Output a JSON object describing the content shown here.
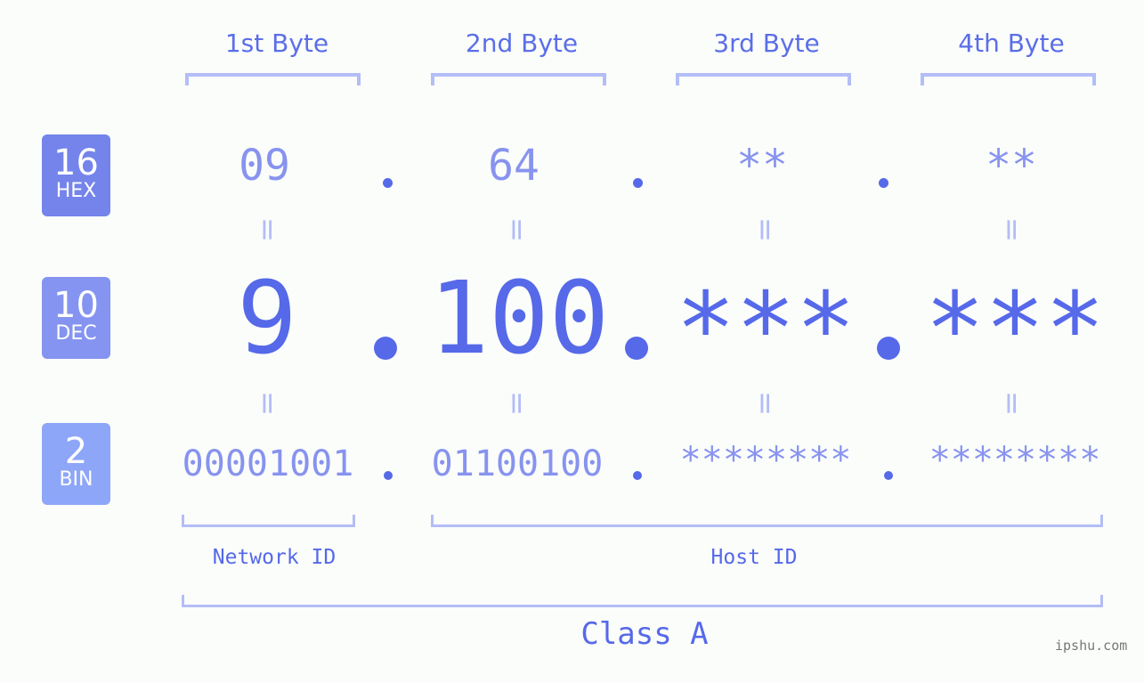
{
  "byte_headers": [
    "1st Byte",
    "2nd Byte",
    "3rd Byte",
    "4th Byte"
  ],
  "badges": [
    {
      "num": "16",
      "label": "HEX",
      "color": "#7484eb"
    },
    {
      "num": "10",
      "label": "DEC",
      "color": "#8494f0"
    },
    {
      "num": "2",
      "label": "BIN",
      "color": "#8ea6f8"
    }
  ],
  "hex": [
    "09",
    "64",
    "**",
    "**"
  ],
  "dec": [
    "9",
    "100",
    "***",
    "***"
  ],
  "bin": [
    "00001001",
    "01100100",
    "********",
    "********"
  ],
  "equals_sign": "=",
  "network_label": "Network ID",
  "host_label": "Host ID",
  "class_label": "Class A",
  "watermark": "ipshu.com",
  "colors": {
    "accent": "#5669e9",
    "light": "#8793ee",
    "bracket": "#b3bdf6"
  }
}
